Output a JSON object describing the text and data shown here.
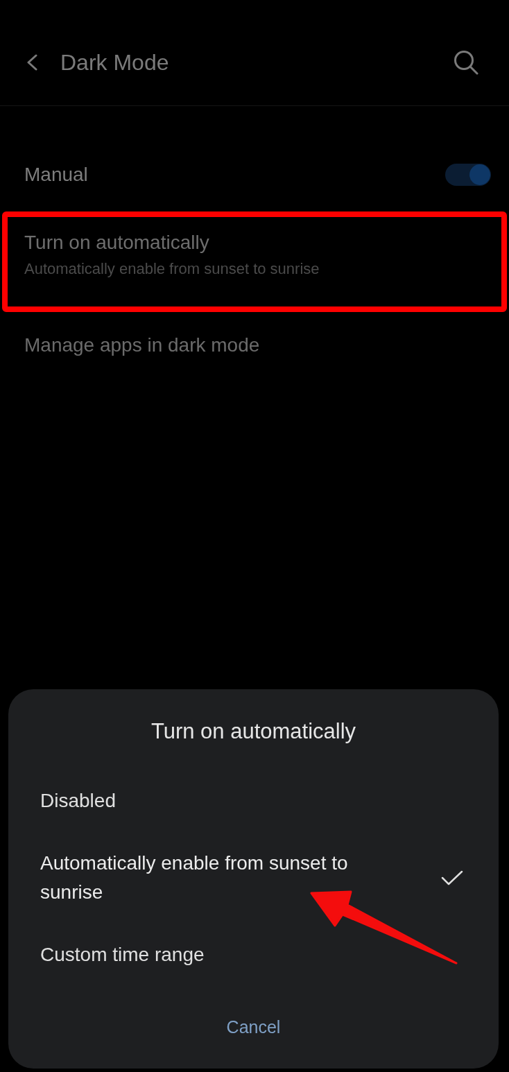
{
  "app_bar": {
    "title": "Dark Mode"
  },
  "settings": [
    {
      "kind": "toggle",
      "label": "Manual",
      "on": true
    },
    {
      "kind": "detail",
      "label": "Turn on automatically",
      "summary": "Automatically enable from sunset to sunrise",
      "highlighted": true
    },
    {
      "kind": "link",
      "label": "Manage apps in dark mode"
    }
  ],
  "dialog": {
    "title": "Turn on automatically",
    "options": [
      {
        "label": "Disabled",
        "selected": false
      },
      {
        "label": "Automatically enable from sunset to sunrise",
        "selected": true
      },
      {
        "label": "Custom time range",
        "selected": false
      }
    ],
    "cancel": "Cancel"
  }
}
